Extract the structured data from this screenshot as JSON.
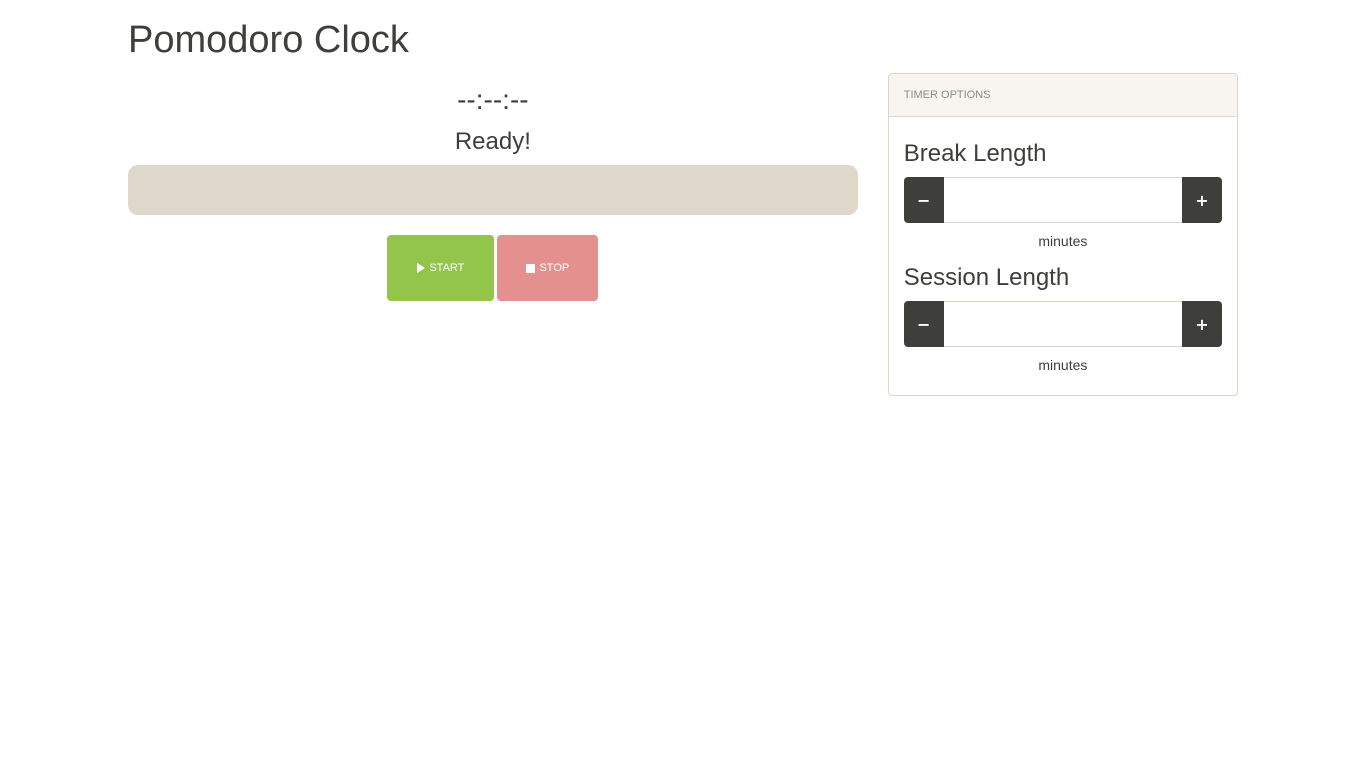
{
  "page": {
    "title": "Pomodoro Clock"
  },
  "timer": {
    "display": "--:--:--",
    "status": "Ready!",
    "progress_percent": 0
  },
  "controls": {
    "start_label": "START",
    "stop_label": "STOP",
    "start_icon": "play-icon",
    "stop_icon": "stop-icon"
  },
  "options_panel": {
    "heading": "TIMER OPTIONS",
    "break": {
      "label": "Break Length",
      "value": "",
      "unit": "minutes",
      "minus_label": "−",
      "plus_label": "+"
    },
    "session": {
      "label": "Session Length",
      "value": "",
      "unit": "minutes",
      "minus_label": "−",
      "plus_label": "+"
    }
  },
  "colors": {
    "text": "#3e3f3a",
    "start": "#93c54b",
    "stop": "#e4908e",
    "progress_track": "#dfd7ca",
    "dark_button": "#3e3f3a",
    "panel_heading_bg": "#f8f5f0"
  }
}
